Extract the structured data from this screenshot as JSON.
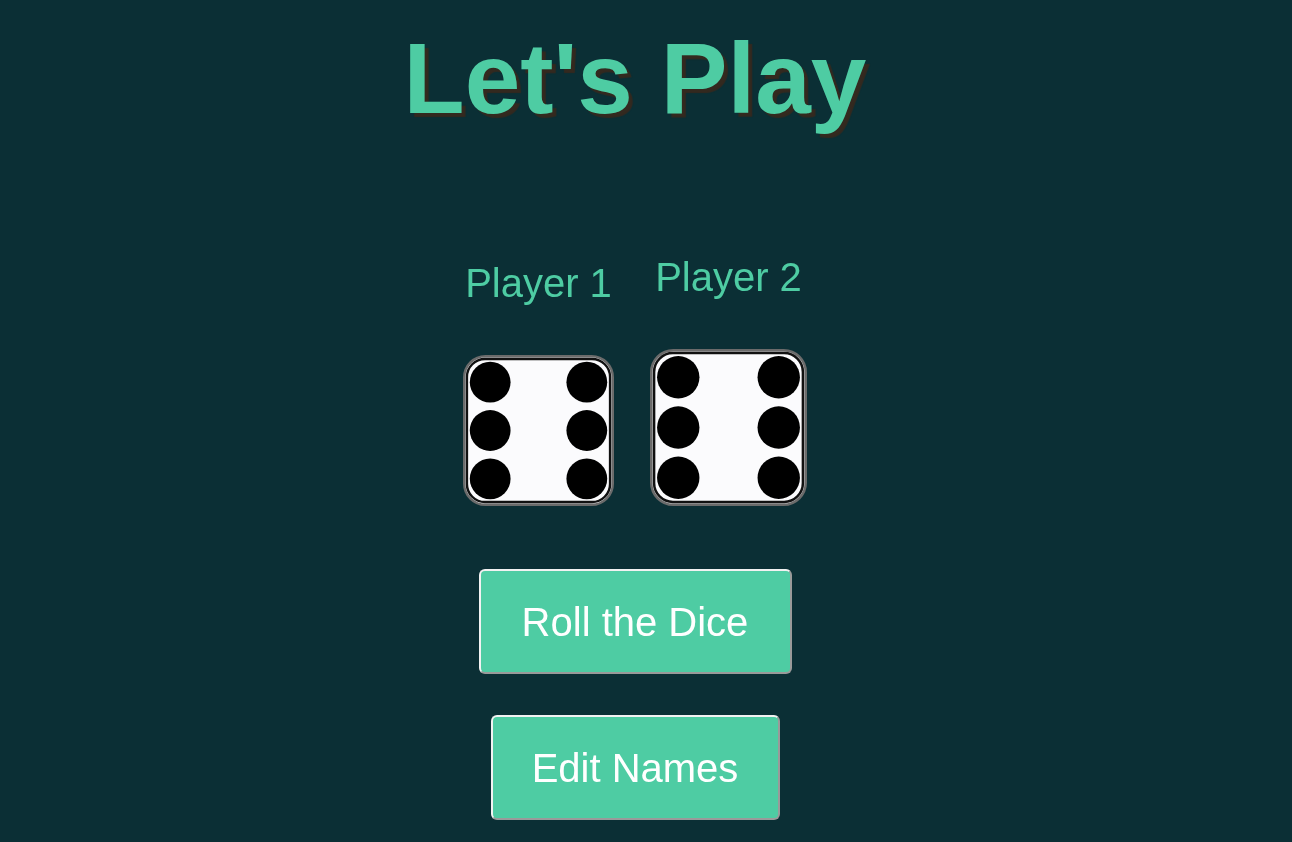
{
  "title": "Let's Play",
  "players": [
    {
      "name": "Player 1",
      "kind": "six"
    },
    {
      "name": "Player 2",
      "kind": "six"
    }
  ],
  "buttons": [
    {
      "label": "Roll the Dice"
    },
    {
      "label": "Edit Names"
    }
  ]
}
